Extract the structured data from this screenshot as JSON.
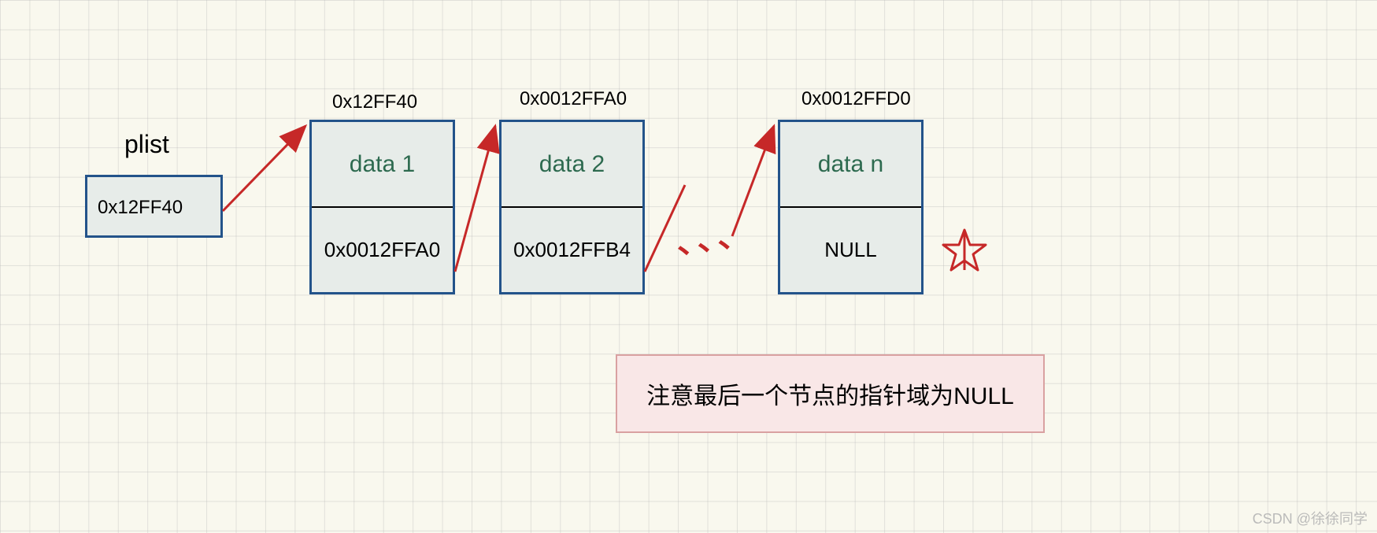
{
  "plist": {
    "label": "plist",
    "value": "0x12FF40"
  },
  "nodes": [
    {
      "address": "0x12FF40",
      "data": "data 1",
      "pointer": "0x0012FFA0"
    },
    {
      "address": "0x0012FFA0",
      "data": "data 2",
      "pointer": "0x0012FFB4"
    },
    {
      "address": "0x0012FFD0",
      "data": "data n",
      "pointer": "NULL"
    }
  ],
  "ellipsis": "、、、",
  "note": "注意最后一个节点的指针域为NULL",
  "watermark": "CSDN @徐徐同学"
}
